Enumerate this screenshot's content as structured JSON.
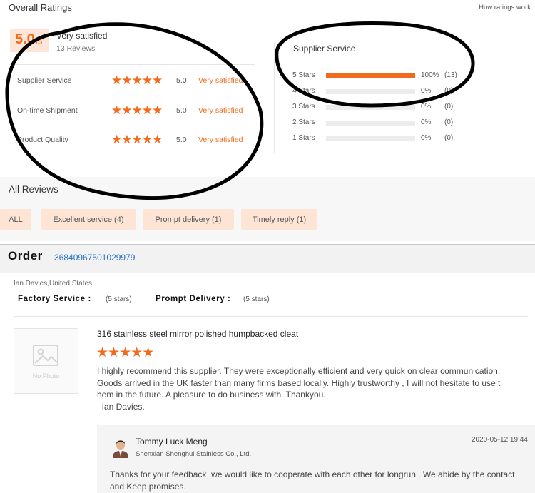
{
  "ratings": {
    "title": "Overall Ratings",
    "how_link": "How ratings work",
    "score": "5.0",
    "score_denominator": "/5",
    "verdict": "Very satisfied",
    "review_count": "13 Reviews",
    "metrics": [
      {
        "label": "Supplier Service",
        "stars": "★★★★★",
        "score": "5.0",
        "verdict": "Very satisfied"
      },
      {
        "label": "On-time Shipment",
        "stars": "★★★★★",
        "score": "5.0",
        "verdict": "Very satisfied"
      },
      {
        "label": "Product Quality",
        "stars": "★★★★★",
        "score": "5.0",
        "verdict": "Very satisfied"
      }
    ],
    "distribution": {
      "title": "Supplier Service",
      "rows": [
        {
          "label": "5 Stars",
          "percent": "100%",
          "count": "(13)",
          "fill": 1.0
        },
        {
          "label": "4 Stars",
          "percent": "0%",
          "count": "(0)",
          "fill": 0
        },
        {
          "label": "3 Stars",
          "percent": "0%",
          "count": "(0)",
          "fill": 0
        },
        {
          "label": "2 Stars",
          "percent": "0%",
          "count": "(0)",
          "fill": 0
        },
        {
          "label": "1 Stars",
          "percent": "0%",
          "count": "(0)",
          "fill": 0
        }
      ]
    }
  },
  "reviews": {
    "title": "All Reviews",
    "filters": [
      "ALL",
      "Excellent service (4)",
      "Prompt delivery (1)",
      "Timely reply (1)"
    ]
  },
  "order": {
    "label": "Order",
    "number": "36840967501029979",
    "buyer": "Ian Davies,United States",
    "services": [
      {
        "title": "Factory Service :",
        "value": "(5 stars)"
      },
      {
        "title": "Prompt Delivery :",
        "value": "(5 stars)"
      }
    ],
    "photo_placeholder": "No Photo",
    "product_title": "316 stainless steel mirror polished humpbacked cleat",
    "stars": "★★★★★",
    "review_lines": [
      "I highly recommend this supplier. They were exceptionally efficient and very quick on clear communication.",
      "Goods arrived in the UK faster than many firms based locally. Highly trustworthy , I will not hesitate to use t",
      "hem in the future. A pleasure to do business with.  Thankyou.",
      "  Ian Davies."
    ],
    "reply": {
      "seller_name": "Tommy Luck Meng",
      "company": "Shenxian Shenghui Stainless Co., Ltd.",
      "date": "2020-05-12 19:44",
      "text_lines": [
        "Thanks for your feedback ,we would like to cooperate with each other for longrun . We abide by the contact",
        "and Keep promises."
      ]
    }
  },
  "colors": {
    "accent": "#f26a1b",
    "accent_light": "#fde4d4",
    "link": "#2a74c7"
  }
}
